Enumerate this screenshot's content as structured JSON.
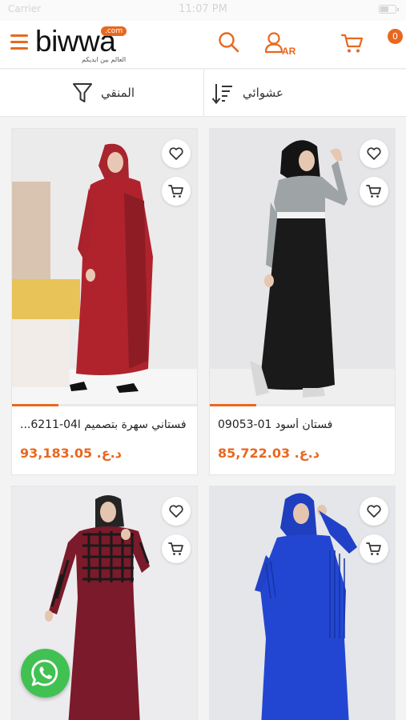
{
  "status_bar": {
    "carrier": "Carrier",
    "time": "11:07 PM"
  },
  "header": {
    "logo_text": "biwwa",
    "logo_com": ".com",
    "tagline": "العالم بين ايديكم",
    "language_label": "AR",
    "cart_count": "0",
    "accent_color": "#e8681f"
  },
  "toolbar": {
    "filter_label": "المنقي",
    "sort_label": "عشوائي"
  },
  "products": [
    {
      "name": "فستاني سهرة بتصميم ا04-6211...",
      "price": "د.ع. 93,183.05"
    },
    {
      "name": "فستان أسود 01-09053",
      "price": "د.ع. 85,722.03"
    },
    {
      "name": "",
      "price": ""
    },
    {
      "name": "",
      "price": ""
    }
  ],
  "icons": [
    "menu-icon",
    "search-icon",
    "user-icon",
    "cart-icon",
    "filter-icon",
    "sort-icon",
    "heart-icon",
    "add-to-cart-icon",
    "whatsapp-icon"
  ]
}
